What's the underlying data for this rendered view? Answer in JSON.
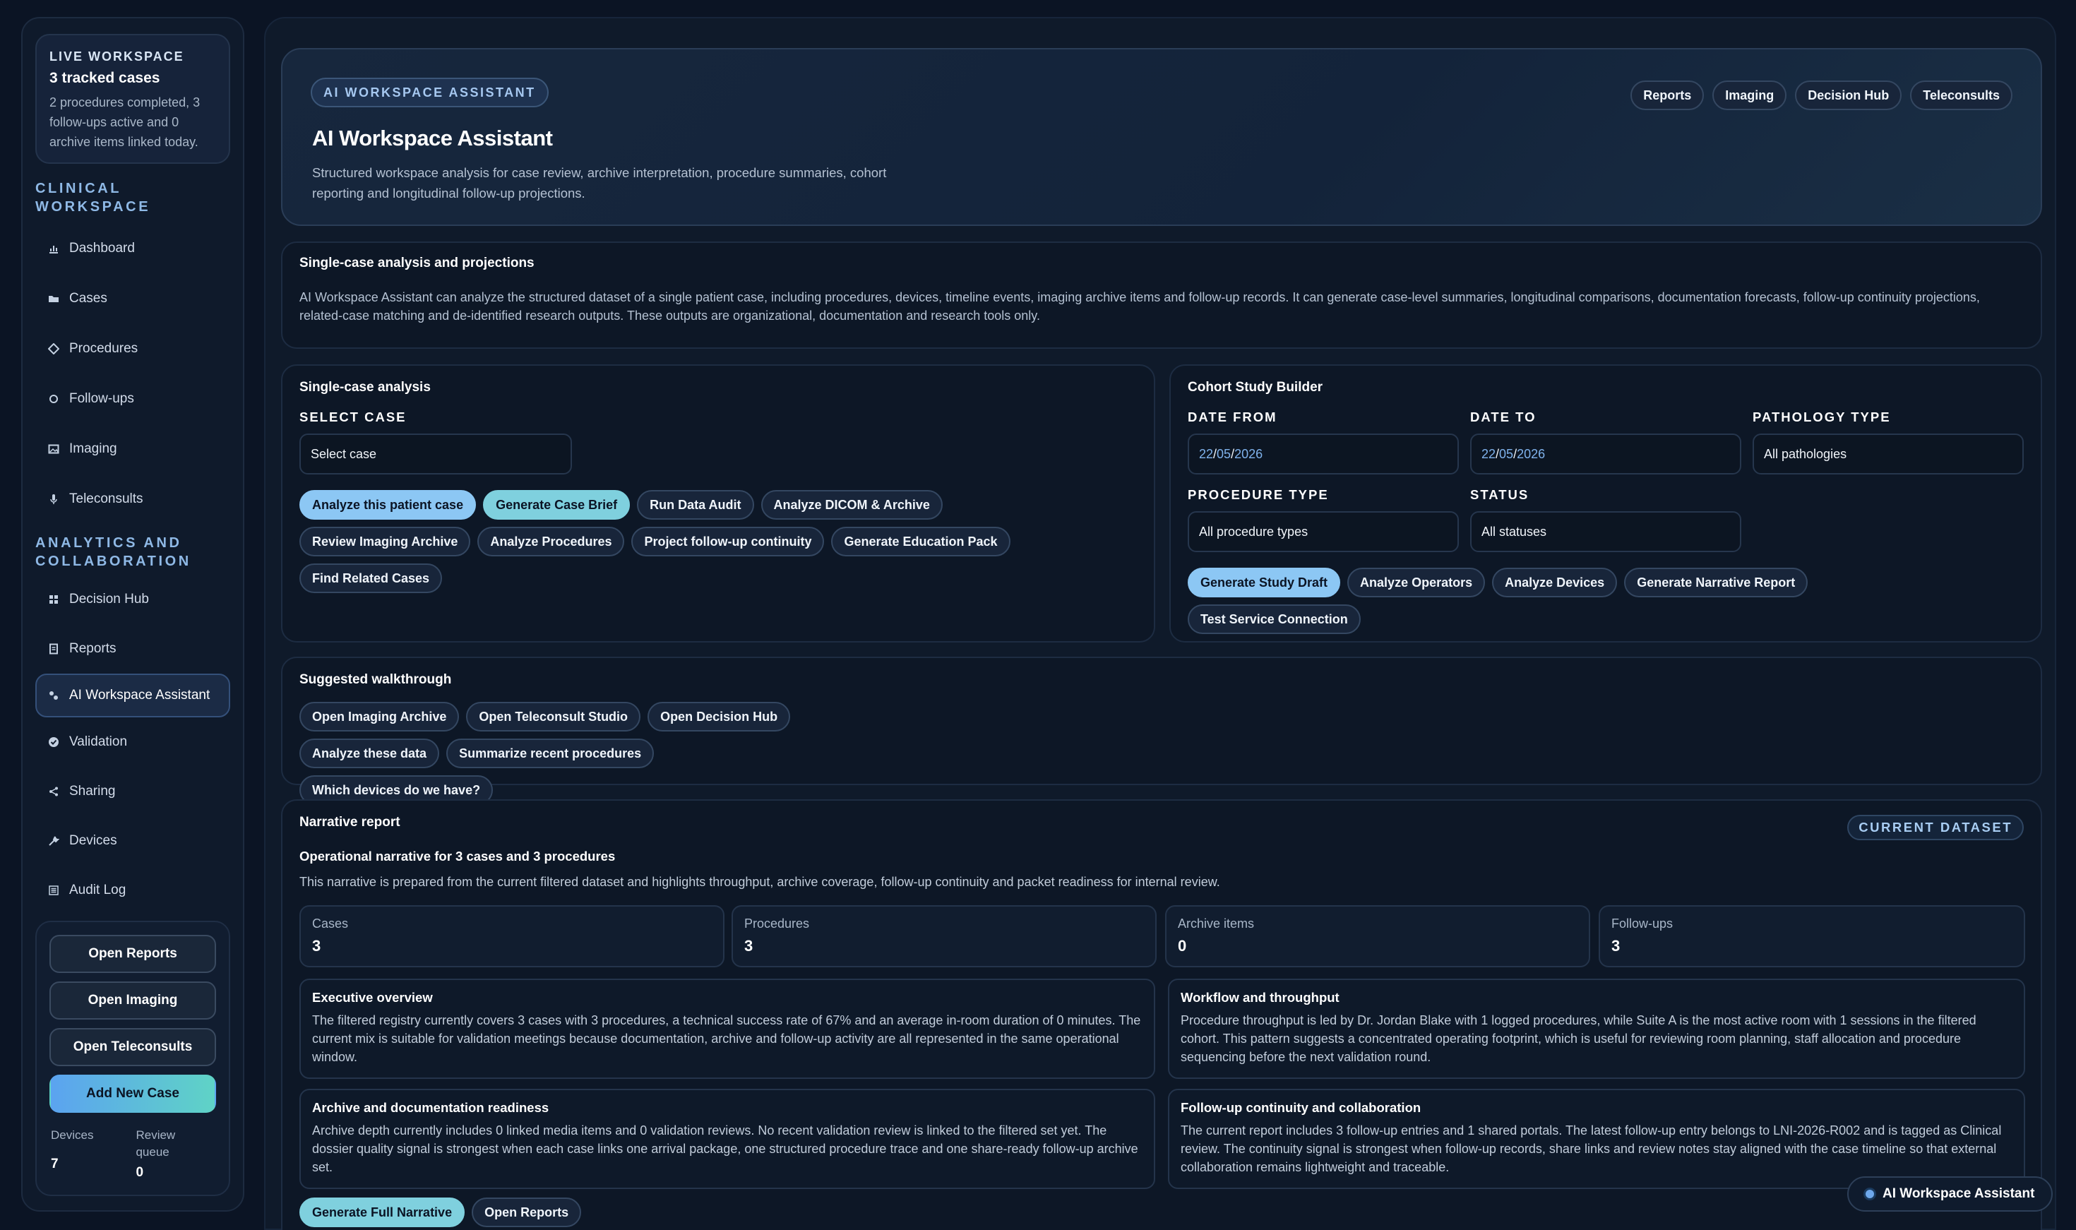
{
  "sidebar": {
    "live": {
      "eyebrow": "LIVE WORKSPACE",
      "title": "3 tracked cases",
      "text": "2 procedures completed, 3 follow-ups active and 0 archive items linked today."
    },
    "section1": "CLINICAL WORKSPACE",
    "items1": [
      {
        "label": "Dashboard",
        "icon": "chart-icon"
      },
      {
        "label": "Cases",
        "icon": "folder-icon"
      },
      {
        "label": "Procedures",
        "icon": "diamond-icon"
      },
      {
        "label": "Follow-ups",
        "icon": "cycle-icon"
      },
      {
        "label": "Imaging",
        "icon": "image-icon"
      },
      {
        "label": "Teleconsults",
        "icon": "microphone-icon"
      }
    ],
    "section2": "ANALYTICS AND COLLABORATION",
    "items2": [
      {
        "label": "Decision Hub",
        "icon": "grid-icon"
      },
      {
        "label": "Reports",
        "icon": "document-icon"
      },
      {
        "label": "AI Workspace Assistant",
        "icon": "assistant-icon"
      },
      {
        "label": "Validation",
        "icon": "check-circle-icon"
      },
      {
        "label": "Sharing",
        "icon": "share-icon"
      },
      {
        "label": "Devices",
        "icon": "wrench-icon"
      },
      {
        "label": "Audit Log",
        "icon": "list-icon"
      }
    ],
    "buttons": {
      "open_reports": "Open Reports",
      "open_imaging": "Open Imaging",
      "open_teleconsults": "Open Teleconsults",
      "add_new_case": "Add New Case"
    },
    "stats": {
      "devices_label": "Devices",
      "devices_value": "7",
      "queue_label": "Review queue",
      "queue_value": "0"
    }
  },
  "hero": {
    "tag": "AI WORKSPACE ASSISTANT",
    "title": "AI Workspace Assistant",
    "description": "Structured workspace analysis for case review, archive interpretation, procedure summaries, cohort reporting and longitudinal follow-up projections.",
    "links": [
      "Reports",
      "Imaging",
      "Decision Hub",
      "Teleconsults"
    ]
  },
  "intro": {
    "title": "Single-case analysis and projections",
    "body": "AI Workspace Assistant can analyze the structured dataset of a single patient case, including procedures, devices, timeline events, imaging archive items and follow-up records. It can generate case-level summaries, longitudinal comparisons, documentation forecasts, follow-up continuity projections, related-case matching and de-identified research outputs. These outputs are organizational, documentation and research tools only."
  },
  "single_case": {
    "title": "Single-case analysis",
    "select_label": "SELECT CASE",
    "select_value": "Select case",
    "actions": [
      "Analyze this patient case",
      "Generate Case Brief",
      "Run Data Audit",
      "Analyze DICOM & Archive",
      "Review Imaging Archive",
      "Analyze Procedures",
      "Project follow-up continuity",
      "Generate Education Pack",
      "Find Related Cases"
    ]
  },
  "cohort": {
    "title": "Cohort Study Builder",
    "date_from_label": "DATE FROM",
    "date_from": {
      "d": "22",
      "m": "05",
      "y": "2026"
    },
    "date_to_label": "DATE TO",
    "date_to": {
      "d": "22",
      "m": "05",
      "y": "2026"
    },
    "pathology_label": "PATHOLOGY TYPE",
    "pathology_value": "All pathologies",
    "procedure_label": "PROCEDURE TYPE",
    "procedure_value": "All procedure types",
    "status_label": "STATUS",
    "status_value": "All statuses",
    "actions": [
      "Generate Study Draft",
      "Analyze Operators",
      "Analyze Devices",
      "Generate Narrative Report",
      "Test Service Connection"
    ]
  },
  "walkthrough": {
    "title": "Suggested walkthrough",
    "actions": [
      "Open Imaging Archive",
      "Open Teleconsult Studio",
      "Open Decision Hub",
      "Analyze these data",
      "Summarize recent procedures",
      "Which devices do we have?"
    ]
  },
  "narrative": {
    "title": "Narrative report",
    "badge": "CURRENT DATASET",
    "heading": "Operational narrative for 3 cases and 3 procedures",
    "intro": "This narrative is prepared from the current filtered dataset and highlights throughput, archive coverage, follow-up continuity and packet readiness for internal review.",
    "metrics": [
      {
        "label": "Cases",
        "value": "3"
      },
      {
        "label": "Procedures",
        "value": "3"
      },
      {
        "label": "Archive items",
        "value": "0"
      },
      {
        "label": "Follow-ups",
        "value": "3"
      }
    ],
    "sections": [
      {
        "title": "Executive overview",
        "body": "The filtered registry currently covers 3 cases with 3 procedures, a technical success rate of 67% and an average in-room duration of 0 minutes. The current mix is suitable for validation meetings because documentation, archive and follow-up activity are all represented in the same operational window."
      },
      {
        "title": "Workflow and throughput",
        "body": "Procedure throughput is led by Dr. Jordan Blake with 1 logged procedures, while Suite A is the most active room with 1 sessions in the filtered cohort. This pattern suggests a concentrated operating footprint, which is useful for reviewing room planning, staff allocation and procedure sequencing before the next validation round."
      },
      {
        "title": "Archive and documentation readiness",
        "body": "Archive depth currently includes 0 linked media items and 0 validation reviews. No recent validation review is linked to the filtered set yet. The dossier quality signal is strongest when each case links one arrival package, one structured procedure trace and one share-ready follow-up archive set."
      },
      {
        "title": "Follow-up continuity and collaboration",
        "body": "The current report includes 3 follow-up entries and 1 shared portals. The latest follow-up entry belongs to LNI-2026-R002 and is tagged as Clinical review. The continuity signal is strongest when follow-up records, share links and review notes stay aligned with the case timeline so that external collaboration remains lightweight and traceable."
      }
    ],
    "actions": [
      "Generate Full Narrative",
      "Open Reports"
    ]
  },
  "floating": {
    "label": "AI Workspace Assistant"
  }
}
